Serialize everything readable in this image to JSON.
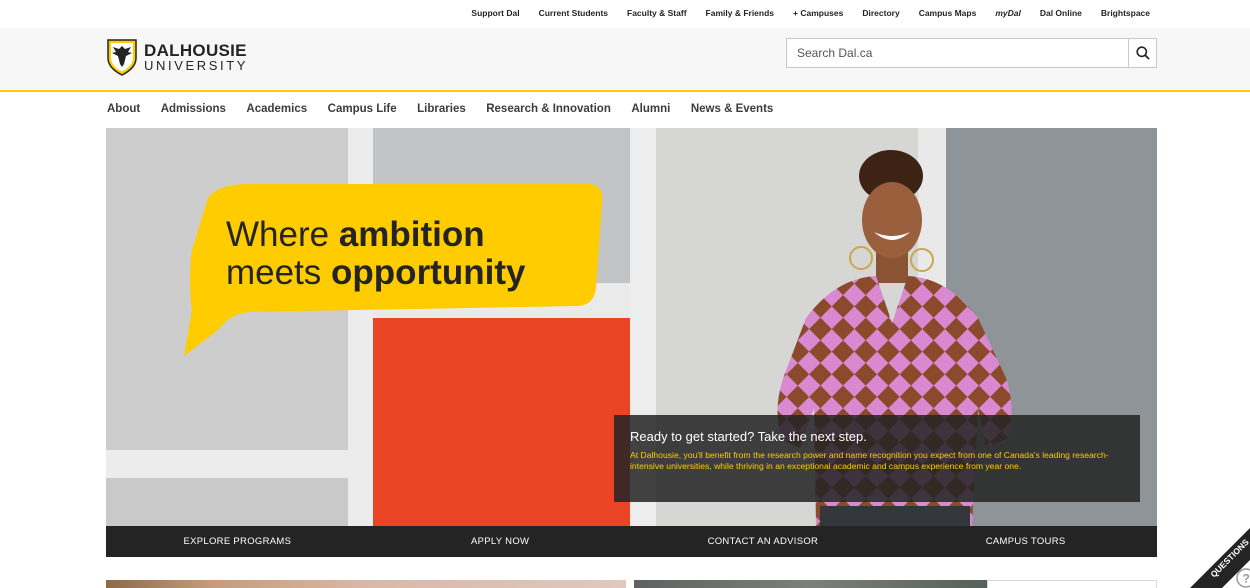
{
  "utility_nav": {
    "items": [
      "Support Dal",
      "Current Students",
      "Faculty & Staff",
      "Family & Friends",
      "+ Campuses",
      "Directory",
      "Campus Maps",
      "myDal",
      "Dal Online",
      "Brightspace"
    ]
  },
  "header": {
    "logo_line1": "DALHOUSIE",
    "logo_line2": "UNIVERSITY",
    "search_placeholder": "Search Dal.ca"
  },
  "main_nav": {
    "items": [
      "About",
      "Admissions",
      "Academics",
      "Campus Life",
      "Libraries",
      "Research & Innovation",
      "Alumni",
      "News & Events"
    ]
  },
  "hero": {
    "headline_line1_a": "Where ",
    "headline_line1_b": "ambition",
    "headline_line2_a": "meets ",
    "headline_line2_b": "opportunity",
    "info_title": "Ready to get started? Take the next step.",
    "info_body": "At Dalhousie, you'll benefit from the research power and name recognition you expect from one of Canada's leading research-intensive universities, while thriving in an exceptional academic and campus experience from year one."
  },
  "cta": {
    "items": [
      "EXPLORE PROGRAMS",
      "APPLY NOW",
      "CONTACT AN ADVISOR",
      "CAMPUS TOURS"
    ]
  },
  "questions_tab": {
    "label": "QUESTIONS",
    "icon": "help-icon"
  },
  "colors": {
    "brand_yellow": "#ffcc00",
    "dark": "#242424",
    "hero_red": "#e94525"
  }
}
